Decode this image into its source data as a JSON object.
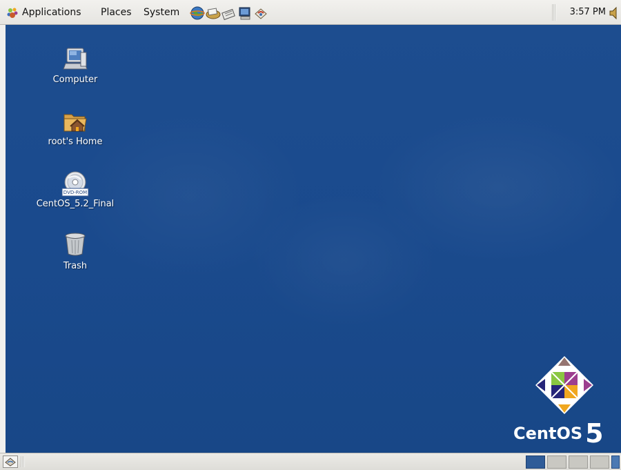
{
  "top_panel": {
    "menus": [
      {
        "label": "Applications"
      },
      {
        "label": "Places"
      },
      {
        "label": "System"
      }
    ],
    "launchers": [
      "web-browser-icon",
      "email-icon",
      "text-editor-icon",
      "terminal-icon",
      "update-icon"
    ],
    "clock": "3:57 PM"
  },
  "desktop": {
    "icons": [
      {
        "label": "Computer",
        "icon": "computer-icon"
      },
      {
        "label": "root's Home",
        "icon": "home-folder-icon"
      },
      {
        "label": "CentOS_5.2_Final",
        "icon": "dvd-icon",
        "badge": "DVD-ROM"
      },
      {
        "label": "Trash",
        "icon": "trash-icon"
      }
    ],
    "logo": {
      "word": "CentOS",
      "version": "5"
    }
  },
  "bottom_panel": {
    "workspaces": [
      "1",
      "2",
      "3",
      "4"
    ],
    "active_workspace": 1
  },
  "colors": {
    "desktop": "#1a4a8d",
    "panel": "#e9e8e4",
    "logo_green": "#8ac641",
    "logo_purple": "#9c3e8f",
    "logo_orange": "#f0a71f",
    "logo_blue": "#262579"
  }
}
